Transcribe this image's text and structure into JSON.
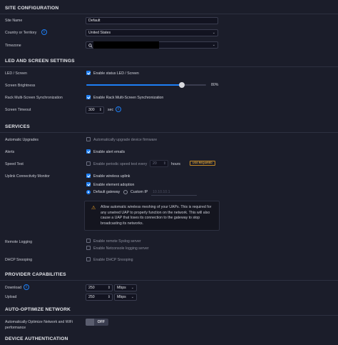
{
  "site": {
    "title": "SITE CONFIGURATION",
    "site_name_label": "Site Name",
    "site_name_value": "Default",
    "country_label": "Country or Territory",
    "country_value": "United States",
    "timezone_label": "Timezone"
  },
  "led": {
    "title": "LED AND SCREEN SETTINGS",
    "led_label": "LED / Screen",
    "led_option": "Enable status LED / Screen",
    "brightness_label": "Screen Brightness",
    "brightness_value": "80%",
    "brightness_fraction": 0.8,
    "rack_label": "Rack Multi-Screen Synchronization",
    "rack_option": "Enable Rack Multi-Screen Synchronization",
    "timeout_label": "Screen Timeout",
    "timeout_value": "300",
    "timeout_unit": "sec"
  },
  "services": {
    "title": "SERVICES",
    "auto_upgrades_label": "Automatic Upgrades",
    "auto_upgrades_option": "Automatically upgrade device firmware",
    "alerts_label": "Alerts",
    "alerts_option": "Enable alert emails",
    "speed_test_label": "Speed Test",
    "speed_test_option": "Enable periodic speed test every",
    "speed_test_value": "20",
    "speed_test_unit": "hours",
    "speed_test_badge": "USG REQUIRED",
    "uplink_label": "Uplink Connectivity Monitor",
    "uplink_option": "Enable wireless uplink",
    "element_option": "Enable element adoption",
    "default_gateway": "Default gateway",
    "custom_ip": "Custom IP",
    "custom_ip_placeholder": "10.10.10.1",
    "warning_text": "Allow automatic wireless meshing of your UAPs. This is required for any unwired UAP to properly function on the network. This will also cause a UAP that loses its connection to the gateway to stop broadcasting its networks.",
    "remote_logging_label": "Remote Logging",
    "syslog_option": "Enable remote Syslog server",
    "netconsole_option": "Enable Netconsole logging server",
    "dhcp_label": "DHCP Snooping",
    "dhcp_option": "Enable DHCP Snooping"
  },
  "provider": {
    "title": "PROVIDER CAPABILITIES",
    "download_label": "Download",
    "download_value": "250",
    "download_unit": "Mbps",
    "upload_label": "Upload",
    "upload_value": "250",
    "upload_unit": "Mbps"
  },
  "auto_optimize": {
    "title": "AUTO-OPTIMIZE NETWORK",
    "label_line1": "Automatically Optimize Network and WiFi",
    "label_line2": "performance",
    "toggle_text": "OFF"
  },
  "device_auth": {
    "title": "DEVICE AUTHENTICATION"
  },
  "colors": {
    "background": "#1b1d2a",
    "accent": "#1e7ff5",
    "warning": "#f5a623"
  }
}
